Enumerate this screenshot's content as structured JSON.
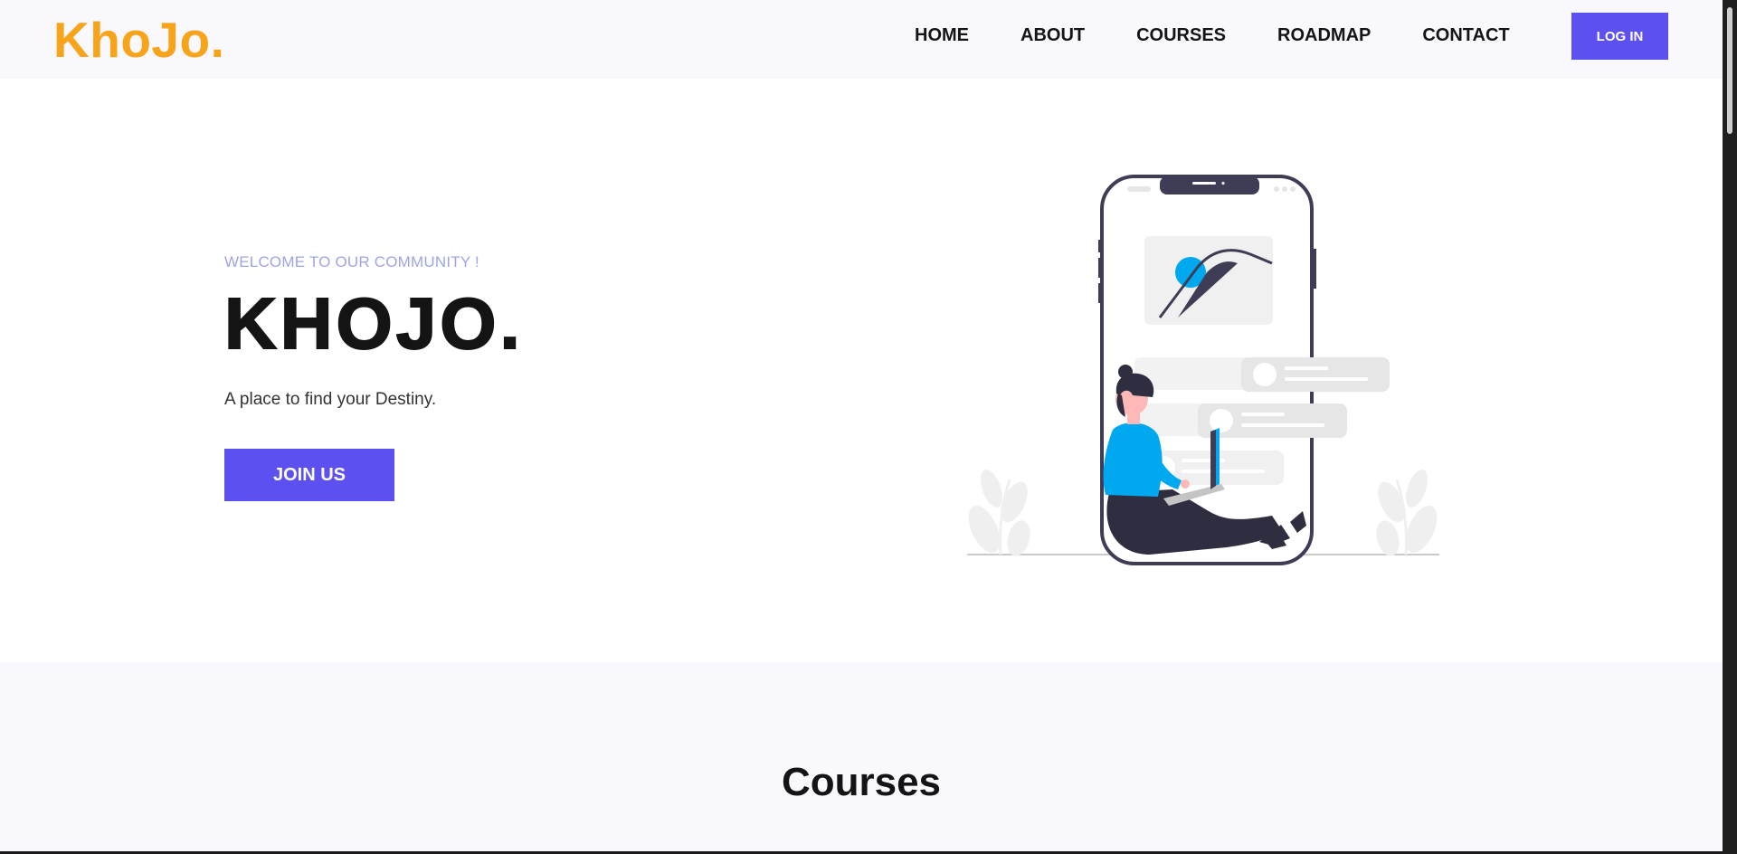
{
  "header": {
    "logo": "KhoJo.",
    "nav": [
      "HOME",
      "ABOUT",
      "COURSES",
      "ROADMAP",
      "CONTACT"
    ],
    "login_label": "LOG IN"
  },
  "hero": {
    "welcome": "WELCOME TO OUR COMMUNITY !",
    "title": "KHOJO.",
    "tagline": "A place to find your Destiny.",
    "join_label": "JOIN US"
  },
  "courses": {
    "title": "Courses"
  },
  "colors": {
    "brand_orange": "#f7a41a",
    "accent_purple": "#5d50f1",
    "welcome_text": "#9ea5e7",
    "section_bg": "#f8f8fd",
    "illustration_blue": "#00a8f0",
    "illustration_dark": "#3f3d56"
  },
  "icons": [
    "hero-illustration-phone-woman-laptop"
  ]
}
